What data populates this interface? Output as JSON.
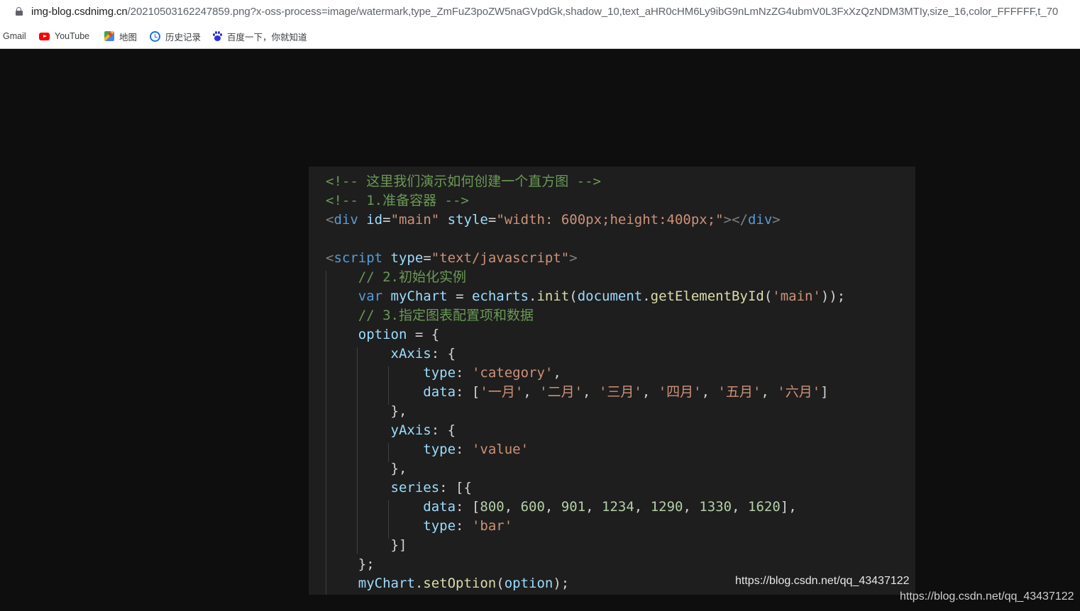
{
  "browser": {
    "url_host": "img-blog.csdnimg.cn",
    "url_rest": "/20210503162247859.png?x-oss-process=image/watermark,type_ZmFuZ3poZW5naGVpdGk,shadow_10,text_aHR0cHM6Ly9ibG9nLmNzZG4ubmV0L3FxXzQzNDM3MTIy,size_16,color_FFFFFF,t_70",
    "bookmarks": [
      {
        "label": "Gmail",
        "icon": "gmail-icon"
      },
      {
        "label": "YouTube",
        "icon": "youtube-icon"
      },
      {
        "label": "地图",
        "icon": "maps-icon"
      },
      {
        "label": "历史记录",
        "icon": "history-icon"
      },
      {
        "label": "百度一下，你就知道",
        "icon": "baidu-icon"
      }
    ]
  },
  "code": {
    "lines": [
      [
        {
          "t": "<!-- 这里我们演示如何创建一个直方图 -->",
          "c": "cm"
        }
      ],
      [
        {
          "t": "<!-- 1.准备容器 -->",
          "c": "cm"
        }
      ],
      [
        {
          "t": "<",
          "c": "pun"
        },
        {
          "t": "div",
          "c": "tag"
        },
        {
          "t": " ",
          "c": "txt"
        },
        {
          "t": "id",
          "c": "attr"
        },
        {
          "t": "=",
          "c": "txt"
        },
        {
          "t": "\"main\"",
          "c": "str"
        },
        {
          "t": " ",
          "c": "txt"
        },
        {
          "t": "style",
          "c": "attr"
        },
        {
          "t": "=",
          "c": "txt"
        },
        {
          "t": "\"width: 600px;height:400px;\"",
          "c": "str"
        },
        {
          "t": "></",
          "c": "pun"
        },
        {
          "t": "div",
          "c": "tag"
        },
        {
          "t": ">",
          "c": "pun"
        }
      ],
      [],
      [
        {
          "t": "<",
          "c": "pun"
        },
        {
          "t": "script",
          "c": "tag"
        },
        {
          "t": " ",
          "c": "txt"
        },
        {
          "t": "type",
          "c": "attr"
        },
        {
          "t": "=",
          "c": "txt"
        },
        {
          "t": "\"text/javascript\"",
          "c": "str"
        },
        {
          "t": ">",
          "c": "pun"
        }
      ],
      [
        {
          "t": "    // 2.初始化实例",
          "c": "cm"
        }
      ],
      [
        {
          "t": "    ",
          "c": "txt"
        },
        {
          "t": "var",
          "c": "kw"
        },
        {
          "t": " ",
          "c": "txt"
        },
        {
          "t": "myChart",
          "c": "var"
        },
        {
          "t": " = ",
          "c": "txt"
        },
        {
          "t": "echarts",
          "c": "var"
        },
        {
          "t": ".",
          "c": "txt"
        },
        {
          "t": "init",
          "c": "fn"
        },
        {
          "t": "(",
          "c": "txt"
        },
        {
          "t": "document",
          "c": "var"
        },
        {
          "t": ".",
          "c": "txt"
        },
        {
          "t": "getElementById",
          "c": "fn"
        },
        {
          "t": "(",
          "c": "txt"
        },
        {
          "t": "'main'",
          "c": "str"
        },
        {
          "t": "));",
          "c": "txt"
        }
      ],
      [
        {
          "t": "    // 3.指定图表配置项和数据",
          "c": "cm"
        }
      ],
      [
        {
          "t": "    ",
          "c": "txt"
        },
        {
          "t": "option",
          "c": "var"
        },
        {
          "t": " = {",
          "c": "txt"
        }
      ],
      [
        {
          "t": "        ",
          "c": "txt"
        },
        {
          "t": "xAxis",
          "c": "var"
        },
        {
          "t": ": {",
          "c": "txt"
        }
      ],
      [
        {
          "t": "            ",
          "c": "txt"
        },
        {
          "t": "type",
          "c": "var"
        },
        {
          "t": ": ",
          "c": "txt"
        },
        {
          "t": "'category'",
          "c": "str"
        },
        {
          "t": ",",
          "c": "txt"
        }
      ],
      [
        {
          "t": "            ",
          "c": "txt"
        },
        {
          "t": "data",
          "c": "var"
        },
        {
          "t": ": [",
          "c": "txt"
        },
        {
          "t": "'一月'",
          "c": "str"
        },
        {
          "t": ", ",
          "c": "txt"
        },
        {
          "t": "'二月'",
          "c": "str"
        },
        {
          "t": ", ",
          "c": "txt"
        },
        {
          "t": "'三月'",
          "c": "str"
        },
        {
          "t": ", ",
          "c": "txt"
        },
        {
          "t": "'四月'",
          "c": "str"
        },
        {
          "t": ", ",
          "c": "txt"
        },
        {
          "t": "'五月'",
          "c": "str"
        },
        {
          "t": ", ",
          "c": "txt"
        },
        {
          "t": "'六月'",
          "c": "str"
        },
        {
          "t": "]",
          "c": "txt"
        }
      ],
      [
        {
          "t": "        },",
          "c": "txt"
        }
      ],
      [
        {
          "t": "        ",
          "c": "txt"
        },
        {
          "t": "yAxis",
          "c": "var"
        },
        {
          "t": ": {",
          "c": "txt"
        }
      ],
      [
        {
          "t": "            ",
          "c": "txt"
        },
        {
          "t": "type",
          "c": "var"
        },
        {
          "t": ": ",
          "c": "txt"
        },
        {
          "t": "'value'",
          "c": "str"
        }
      ],
      [
        {
          "t": "        },",
          "c": "txt"
        }
      ],
      [
        {
          "t": "        ",
          "c": "txt"
        },
        {
          "t": "series",
          "c": "var"
        },
        {
          "t": ": [{",
          "c": "txt"
        }
      ],
      [
        {
          "t": "            ",
          "c": "txt"
        },
        {
          "t": "data",
          "c": "var"
        },
        {
          "t": ": [",
          "c": "txt"
        },
        {
          "t": "800",
          "c": "num"
        },
        {
          "t": ", ",
          "c": "txt"
        },
        {
          "t": "600",
          "c": "num"
        },
        {
          "t": ", ",
          "c": "txt"
        },
        {
          "t": "901",
          "c": "num"
        },
        {
          "t": ", ",
          "c": "txt"
        },
        {
          "t": "1234",
          "c": "num"
        },
        {
          "t": ", ",
          "c": "txt"
        },
        {
          "t": "1290",
          "c": "num"
        },
        {
          "t": ", ",
          "c": "txt"
        },
        {
          "t": "1330",
          "c": "num"
        },
        {
          "t": ", ",
          "c": "txt"
        },
        {
          "t": "1620",
          "c": "num"
        },
        {
          "t": "],",
          "c": "txt"
        }
      ],
      [
        {
          "t": "            ",
          "c": "txt"
        },
        {
          "t": "type",
          "c": "var"
        },
        {
          "t": ": ",
          "c": "txt"
        },
        {
          "t": "'bar'",
          "c": "str"
        }
      ],
      [
        {
          "t": "        }]",
          "c": "txt"
        }
      ],
      [
        {
          "t": "    };",
          "c": "txt"
        }
      ],
      [
        {
          "t": "    ",
          "c": "txt"
        },
        {
          "t": "myChart",
          "c": "var"
        },
        {
          "t": ".",
          "c": "txt"
        },
        {
          "t": "setOption",
          "c": "fn"
        },
        {
          "t": "(",
          "c": "txt"
        },
        {
          "t": "option",
          "c": "var"
        },
        {
          "t": ");",
          "c": "txt"
        }
      ]
    ]
  },
  "watermark": {
    "inner": "https://blog.csdn.net/qq_43437122",
    "outer": "https://blog.csdn.net/qq_43437122"
  }
}
